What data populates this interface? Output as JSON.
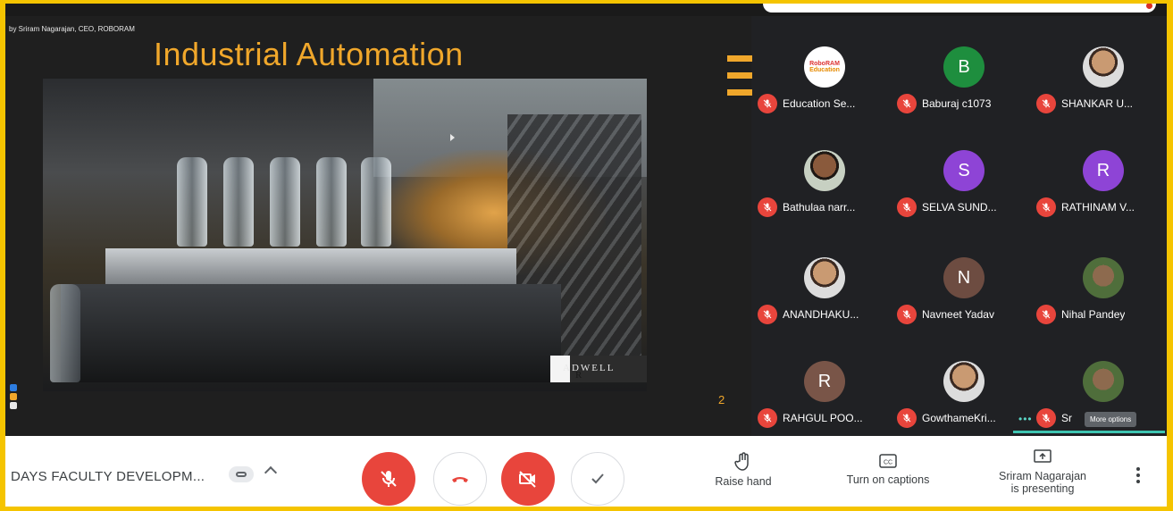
{
  "presentation": {
    "credit": "by Sriram Nagarajan, CEO, ROBORAM",
    "title": "Industrial Automation",
    "watermark_initial": "R",
    "watermark_rest": "ADWELL",
    "page_number": "2"
  },
  "participants": [
    {
      "name": "Education Se...",
      "avatar_type": "logo",
      "logo_top": "RoboRAM",
      "logo_bottom": "Education"
    },
    {
      "name": "Baburaj c1073",
      "avatar_type": "letter",
      "letter": "B",
      "color": "#1e8e3e"
    },
    {
      "name": "SHANKAR U...",
      "avatar_type": "photo"
    },
    {
      "name": "Bathulaa narr...",
      "avatar_type": "photo"
    },
    {
      "name": "SELVA SUND...",
      "avatar_type": "letter",
      "letter": "S",
      "color": "#8e44d6"
    },
    {
      "name": "RATHINAM V...",
      "avatar_type": "letter",
      "letter": "R",
      "color": "#8e44d6"
    },
    {
      "name": "ANANDHAKU...",
      "avatar_type": "photo"
    },
    {
      "name": "Navneet Yadav",
      "avatar_type": "letter",
      "letter": "N",
      "color": "#6d4c41"
    },
    {
      "name": "Nihal Pandey",
      "avatar_type": "photo"
    },
    {
      "name": "RAHGUL POO...",
      "avatar_type": "letter",
      "letter": "R",
      "color": "#795548"
    },
    {
      "name": "GowthameKri...",
      "avatar_type": "photo"
    },
    {
      "name": "Sr",
      "avatar_type": "photo"
    }
  ],
  "tooltip": "More options",
  "bottom_bar": {
    "meeting_title": "DAYS FACULTY DEVELOPM...",
    "raise_hand": "Raise hand",
    "captions": "Turn on captions",
    "presenting_line1": "Sriram Nagarajan",
    "presenting_line2": "is presenting"
  },
  "colors": {
    "accent_orange": "#f0a72b",
    "mute_red": "#e8453c",
    "background": "#202124"
  }
}
